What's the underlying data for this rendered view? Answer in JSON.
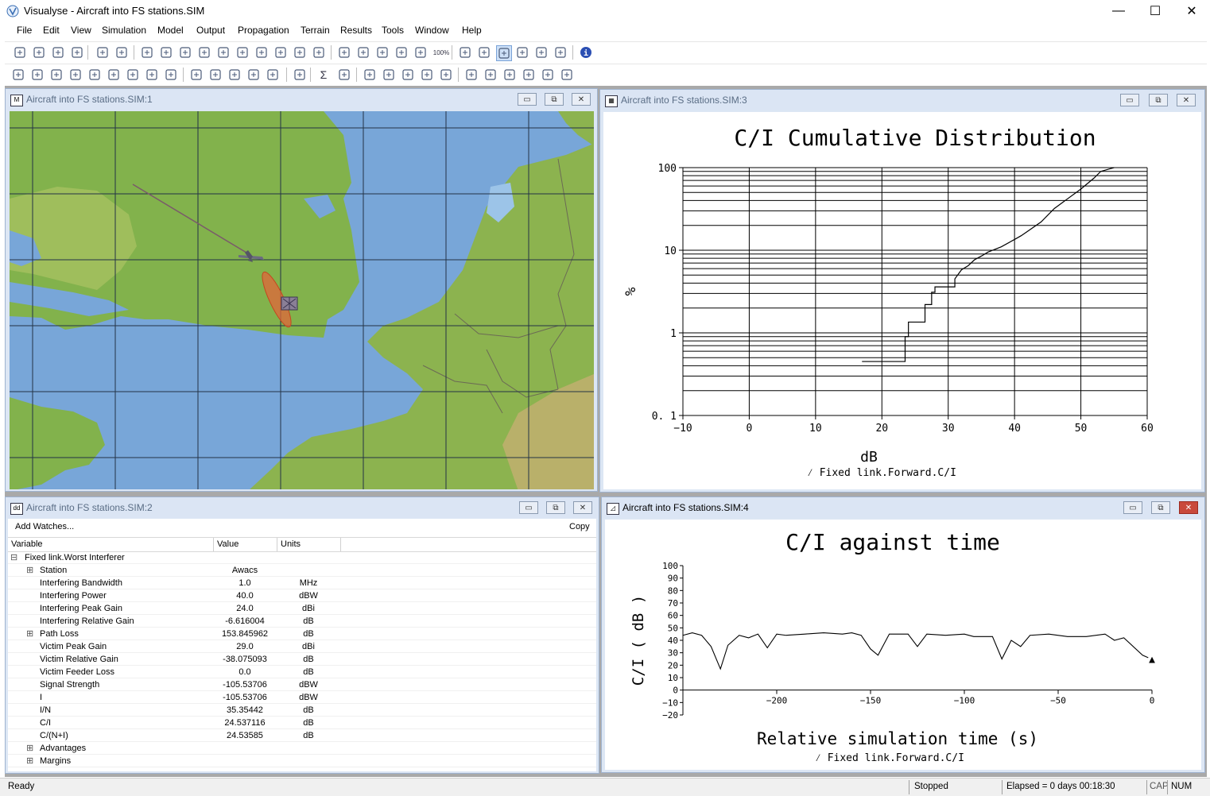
{
  "app": {
    "title": "Visualyse - Aircraft into FS stations.SIM",
    "minimize_glyph": "—",
    "maximize_glyph": "☐",
    "close_glyph": "✕"
  },
  "menu": [
    {
      "label": "File"
    },
    {
      "label": "Edit"
    },
    {
      "label": "View"
    },
    {
      "label": "Simulation"
    },
    {
      "label": "Model"
    },
    {
      "label": "Output"
    },
    {
      "label": "Propagation"
    },
    {
      "label": "Terrain"
    },
    {
      "label": "Results"
    },
    {
      "label": "Tools"
    },
    {
      "label": "Window"
    },
    {
      "label": "Help"
    }
  ],
  "toolbar1": {
    "icons": [
      "new-simulation-icon",
      "open-folder-icon",
      "save-icon",
      "close-file-icon",
      "print-icon",
      "print-preview-icon",
      "plan-view-icon",
      "map-view-icon",
      "globe-view-icon",
      "report-icon",
      "watch-window-icon",
      "table-icon",
      "window-icon",
      "image-icon",
      "copy-window-icon",
      "tile-windows-icon",
      "select-pointer-icon",
      "move-pointer-icon",
      "zoom-select-icon",
      "zoom-in-icon",
      "zoom-out-icon",
      "zoom-100-icon",
      "timer-icon",
      "rewind-icon",
      "stop-icon",
      "step-icon",
      "play-icon",
      "fast-forward-icon",
      "info-icon"
    ],
    "zoom100_label": "100%"
  },
  "toolbar2": {
    "icons": [
      "antenna-icon",
      "ground-station-icon",
      "satellite-group-icon",
      "frequency-icon",
      "link-icon",
      "multi-link-icon",
      "interference-path-icon",
      "network-icon",
      "move-station-icon",
      "satellite-icon",
      "satellite-beam-icon",
      "aircraft-icon",
      "plane-icon",
      "missile-icon",
      "refresh-icon",
      "sum-icon",
      "document-edit-icon",
      "watch-add-icon",
      "area-analysis-icon",
      "line-graph-icon",
      "scatter-graph-icon",
      "histogram-icon",
      "terrain-profile-icon",
      "coverage-icon",
      "coverage-2-icon",
      "coverage-3-icon",
      "coverage-4-icon",
      "coverage-export-icon"
    ],
    "sigma": "Σ"
  },
  "windows": {
    "map": {
      "title": "Aircraft into FS stations.SIM:1",
      "icon_letter": "M"
    },
    "cdf": {
      "title": "Aircraft into FS stations.SIM:3"
    },
    "watch": {
      "title": "Aircraft into FS stations.SIM:2"
    },
    "time": {
      "title": "Aircraft into FS stations.SIM:4"
    }
  },
  "watch": {
    "add_label": "Add Watches...",
    "copy_label": "Copy",
    "headers": [
      "Variable",
      "Value",
      "Units"
    ],
    "rows": [
      {
        "expander": "⊟",
        "indent": 1,
        "name": "Fixed link.Worst Interferer",
        "value": "",
        "units": ""
      },
      {
        "expander": "⊞",
        "indent": 2,
        "name": "Station",
        "value": "Awacs",
        "units": ""
      },
      {
        "expander": "",
        "indent": 2,
        "name": "Interfering Bandwidth",
        "value": "1.0",
        "units": "MHz"
      },
      {
        "expander": "",
        "indent": 2,
        "name": "Interfering Power",
        "value": "40.0",
        "units": "dBW"
      },
      {
        "expander": "",
        "indent": 2,
        "name": "Interfering Peak Gain",
        "value": "24.0",
        "units": "dBi"
      },
      {
        "expander": "",
        "indent": 2,
        "name": "Interfering Relative Gain",
        "value": "-6.616004",
        "units": "dB"
      },
      {
        "expander": "⊞",
        "indent": 2,
        "name": "Path Loss",
        "value": "153.845962",
        "units": "dB"
      },
      {
        "expander": "",
        "indent": 2,
        "name": "Victim Peak Gain",
        "value": "29.0",
        "units": "dBi"
      },
      {
        "expander": "",
        "indent": 2,
        "name": "Victim Relative Gain",
        "value": "-38.075093",
        "units": "dB"
      },
      {
        "expander": "",
        "indent": 2,
        "name": "Victim Feeder Loss",
        "value": "0.0",
        "units": "dB"
      },
      {
        "expander": "",
        "indent": 2,
        "name": "Signal Strength",
        "value": "-105.53706",
        "units": "dBW"
      },
      {
        "expander": "",
        "indent": 2,
        "name": "I",
        "value": "-105.53706",
        "units": "dBW"
      },
      {
        "expander": "",
        "indent": 2,
        "name": "I/N",
        "value": "35.35442",
        "units": "dB"
      },
      {
        "expander": "",
        "indent": 2,
        "name": "C/I",
        "value": "24.537116",
        "units": "dB"
      },
      {
        "expander": "",
        "indent": 2,
        "name": "C/(N+I)",
        "value": "24.53585",
        "units": "dB"
      },
      {
        "expander": "⊞",
        "indent": 2,
        "name": "Advantages",
        "value": "",
        "units": ""
      },
      {
        "expander": "⊞",
        "indent": 2,
        "name": "Margins",
        "value": "",
        "units": ""
      }
    ]
  },
  "chart_data": [
    {
      "type": "line",
      "title": "C/I Cumulative Distribution",
      "xlabel": "dB",
      "ylabel": "%",
      "legend": "⁄ Fixed link.Forward.C/I",
      "xlim": [
        -10,
        60
      ],
      "ylim": [
        0.1,
        100
      ],
      "yscale": "log",
      "x_ticks": [
        -10,
        0,
        10,
        20,
        30,
        40,
        50,
        60
      ],
      "x_tick_labels": [
        "−10",
        "0",
        "10",
        "20",
        "30",
        "40",
        "50",
        "60"
      ],
      "y_ticks": [
        0.1,
        1,
        10,
        100
      ],
      "y_tick_labels": [
        "0. 1",
        "1",
        "10",
        "100"
      ],
      "grid": true,
      "series": [
        {
          "points": [
            [
              17,
              0.45
            ],
            [
              23.5,
              0.45
            ],
            [
              23.5,
              0.9
            ],
            [
              24,
              0.9
            ],
            [
              24,
              1.35
            ],
            [
              26.5,
              1.35
            ],
            [
              26.5,
              2.2
            ],
            [
              27.5,
              2.2
            ],
            [
              27.5,
              3.1
            ],
            [
              28,
              3.1
            ],
            [
              28,
              3.6
            ],
            [
              31,
              3.6
            ],
            [
              31,
              4.5
            ],
            [
              32,
              5.8
            ],
            [
              33,
              6.5
            ],
            [
              34,
              7.7
            ],
            [
              35,
              8.5
            ],
            [
              36,
              9.5
            ],
            [
              38,
              11
            ],
            [
              40,
              13.5
            ],
            [
              41,
              15
            ],
            [
              42,
              17
            ],
            [
              44,
              22
            ],
            [
              46,
              32
            ],
            [
              48,
              42
            ],
            [
              50,
              55
            ],
            [
              52,
              75
            ],
            [
              53,
              90
            ],
            [
              55,
              100
            ]
          ]
        }
      ]
    },
    {
      "type": "line",
      "title": "C/I against time",
      "xlabel": "Relative simulation time (s)",
      "ylabel": "C/I ( dB )",
      "legend": "⁄ Fixed link.Forward.C/I",
      "xlim": [
        -250,
        0
      ],
      "ylim": [
        -20,
        100
      ],
      "x_ticks": [
        -200,
        -150,
        -100,
        -50,
        0
      ],
      "x_tick_labels": [
        "−200",
        "−150",
        "−100",
        "−50",
        "0"
      ],
      "y_ticks": [
        -20,
        -10,
        0,
        10,
        20,
        30,
        40,
        50,
        60,
        70,
        80,
        90,
        100
      ],
      "y_tick_labels": [
        "−20",
        "−10",
        "0",
        "10",
        "20",
        "30",
        "40",
        "50",
        "60",
        "70",
        "80",
        "90",
        "100"
      ],
      "marker": "▲",
      "series": [
        {
          "points": [
            [
              -250,
              44
            ],
            [
              -245,
              46
            ],
            [
              -240,
              44
            ],
            [
              -235,
              35
            ],
            [
              -230,
              17
            ],
            [
              -226,
              36
            ],
            [
              -220,
              44
            ],
            [
              -215,
              42
            ],
            [
              -210,
              45
            ],
            [
              -205,
              34
            ],
            [
              -200,
              45
            ],
            [
              -195,
              44
            ],
            [
              -185,
              45
            ],
            [
              -175,
              46
            ],
            [
              -165,
              45
            ],
            [
              -160,
              46
            ],
            [
              -155,
              44
            ],
            [
              -150,
              33
            ],
            [
              -146,
              28
            ],
            [
              -140,
              45
            ],
            [
              -130,
              45
            ],
            [
              -125,
              35
            ],
            [
              -120,
              45
            ],
            [
              -110,
              44
            ],
            [
              -100,
              45
            ],
            [
              -95,
              43
            ],
            [
              -85,
              43
            ],
            [
              -80,
              25
            ],
            [
              -75,
              40
            ],
            [
              -70,
              35
            ],
            [
              -65,
              44
            ],
            [
              -55,
              45
            ],
            [
              -45,
              43
            ],
            [
              -35,
              43
            ],
            [
              -25,
              45
            ],
            [
              -20,
              40
            ],
            [
              -15,
              42
            ],
            [
              -5,
              28
            ],
            [
              -2,
              26
            ]
          ]
        }
      ]
    }
  ],
  "map": {
    "land_color": "#7cae4a",
    "sea_color": "#7aa8da",
    "grid_color": "#233346",
    "ellipse_color": "#e0653a"
  },
  "status": {
    "ready": "Ready",
    "state": "Stopped",
    "elapsed": "Elapsed = 0 days 00:18:30",
    "cap": "CAP",
    "num": "NUM"
  }
}
